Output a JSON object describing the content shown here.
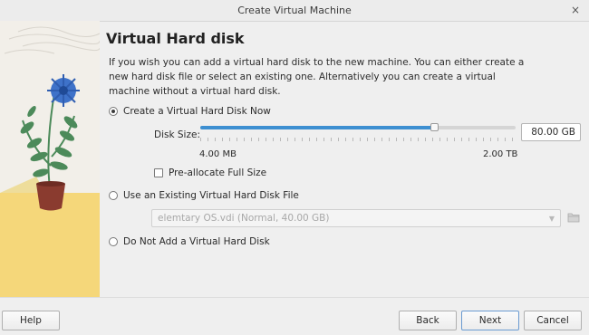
{
  "window": {
    "title": "Create Virtual Machine",
    "close_glyph": "×"
  },
  "page": {
    "heading": "Virtual Hard disk",
    "description": "If you wish you can add a virtual hard disk to the new machine. You can either create a new hard disk file or select an existing one. Alternatively you can create a virtual machine without a virtual hard disk."
  },
  "options": {
    "create_new": {
      "label": "Create a Virtual Hard Disk Now",
      "selected": true
    },
    "use_existing": {
      "label": "Use an Existing Virtual Hard Disk File",
      "selected": false
    },
    "no_disk": {
      "label": "Do Not Add a Virtual Hard Disk",
      "selected": false
    }
  },
  "disk_size": {
    "label": "Disk Size:",
    "value": "80.00 GB",
    "min_label": "4.00 MB",
    "max_label": "2.00 TB",
    "slider_fraction": 0.74
  },
  "preallocate": {
    "label": "Pre-allocate Full Size",
    "checked": false
  },
  "existing_file": {
    "selected": "elemtary OS.vdi (Normal, 40.00 GB)",
    "enabled": false
  },
  "buttons": {
    "help": "Help",
    "back": "Back",
    "next": "Next",
    "cancel": "Cancel"
  },
  "icons": {
    "close": "close-icon",
    "folder": "folder-open-icon",
    "combo_arrow": "chevron-down-icon"
  },
  "colors": {
    "accent": "#3d8fd1",
    "art_background": "#f2efe9",
    "art_sun": "#f5d77a",
    "flower": "#3e72c9",
    "leaves": "#4c8a5a",
    "pot": "#8a3b2f"
  }
}
